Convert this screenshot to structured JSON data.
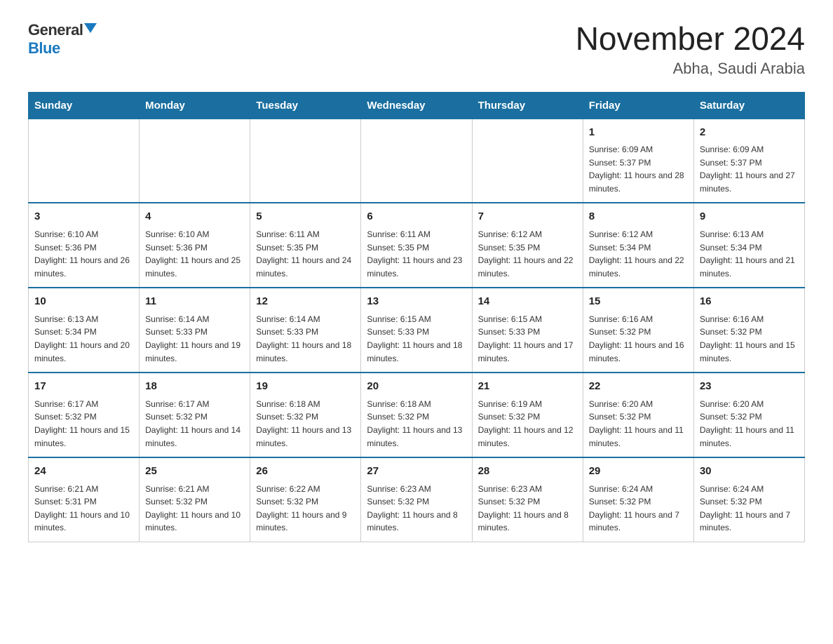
{
  "logo": {
    "general": "General",
    "blue": "Blue"
  },
  "title": "November 2024",
  "subtitle": "Abha, Saudi Arabia",
  "weekdays": [
    "Sunday",
    "Monday",
    "Tuesday",
    "Wednesday",
    "Thursday",
    "Friday",
    "Saturday"
  ],
  "weeks": [
    [
      {
        "day": "",
        "info": ""
      },
      {
        "day": "",
        "info": ""
      },
      {
        "day": "",
        "info": ""
      },
      {
        "day": "",
        "info": ""
      },
      {
        "day": "",
        "info": ""
      },
      {
        "day": "1",
        "info": "Sunrise: 6:09 AM\nSunset: 5:37 PM\nDaylight: 11 hours and 28 minutes."
      },
      {
        "day": "2",
        "info": "Sunrise: 6:09 AM\nSunset: 5:37 PM\nDaylight: 11 hours and 27 minutes."
      }
    ],
    [
      {
        "day": "3",
        "info": "Sunrise: 6:10 AM\nSunset: 5:36 PM\nDaylight: 11 hours and 26 minutes."
      },
      {
        "day": "4",
        "info": "Sunrise: 6:10 AM\nSunset: 5:36 PM\nDaylight: 11 hours and 25 minutes."
      },
      {
        "day": "5",
        "info": "Sunrise: 6:11 AM\nSunset: 5:35 PM\nDaylight: 11 hours and 24 minutes."
      },
      {
        "day": "6",
        "info": "Sunrise: 6:11 AM\nSunset: 5:35 PM\nDaylight: 11 hours and 23 minutes."
      },
      {
        "day": "7",
        "info": "Sunrise: 6:12 AM\nSunset: 5:35 PM\nDaylight: 11 hours and 22 minutes."
      },
      {
        "day": "8",
        "info": "Sunrise: 6:12 AM\nSunset: 5:34 PM\nDaylight: 11 hours and 22 minutes."
      },
      {
        "day": "9",
        "info": "Sunrise: 6:13 AM\nSunset: 5:34 PM\nDaylight: 11 hours and 21 minutes."
      }
    ],
    [
      {
        "day": "10",
        "info": "Sunrise: 6:13 AM\nSunset: 5:34 PM\nDaylight: 11 hours and 20 minutes."
      },
      {
        "day": "11",
        "info": "Sunrise: 6:14 AM\nSunset: 5:33 PM\nDaylight: 11 hours and 19 minutes."
      },
      {
        "day": "12",
        "info": "Sunrise: 6:14 AM\nSunset: 5:33 PM\nDaylight: 11 hours and 18 minutes."
      },
      {
        "day": "13",
        "info": "Sunrise: 6:15 AM\nSunset: 5:33 PM\nDaylight: 11 hours and 18 minutes."
      },
      {
        "day": "14",
        "info": "Sunrise: 6:15 AM\nSunset: 5:33 PM\nDaylight: 11 hours and 17 minutes."
      },
      {
        "day": "15",
        "info": "Sunrise: 6:16 AM\nSunset: 5:32 PM\nDaylight: 11 hours and 16 minutes."
      },
      {
        "day": "16",
        "info": "Sunrise: 6:16 AM\nSunset: 5:32 PM\nDaylight: 11 hours and 15 minutes."
      }
    ],
    [
      {
        "day": "17",
        "info": "Sunrise: 6:17 AM\nSunset: 5:32 PM\nDaylight: 11 hours and 15 minutes."
      },
      {
        "day": "18",
        "info": "Sunrise: 6:17 AM\nSunset: 5:32 PM\nDaylight: 11 hours and 14 minutes."
      },
      {
        "day": "19",
        "info": "Sunrise: 6:18 AM\nSunset: 5:32 PM\nDaylight: 11 hours and 13 minutes."
      },
      {
        "day": "20",
        "info": "Sunrise: 6:18 AM\nSunset: 5:32 PM\nDaylight: 11 hours and 13 minutes."
      },
      {
        "day": "21",
        "info": "Sunrise: 6:19 AM\nSunset: 5:32 PM\nDaylight: 11 hours and 12 minutes."
      },
      {
        "day": "22",
        "info": "Sunrise: 6:20 AM\nSunset: 5:32 PM\nDaylight: 11 hours and 11 minutes."
      },
      {
        "day": "23",
        "info": "Sunrise: 6:20 AM\nSunset: 5:32 PM\nDaylight: 11 hours and 11 minutes."
      }
    ],
    [
      {
        "day": "24",
        "info": "Sunrise: 6:21 AM\nSunset: 5:31 PM\nDaylight: 11 hours and 10 minutes."
      },
      {
        "day": "25",
        "info": "Sunrise: 6:21 AM\nSunset: 5:32 PM\nDaylight: 11 hours and 10 minutes."
      },
      {
        "day": "26",
        "info": "Sunrise: 6:22 AM\nSunset: 5:32 PM\nDaylight: 11 hours and 9 minutes."
      },
      {
        "day": "27",
        "info": "Sunrise: 6:23 AM\nSunset: 5:32 PM\nDaylight: 11 hours and 8 minutes."
      },
      {
        "day": "28",
        "info": "Sunrise: 6:23 AM\nSunset: 5:32 PM\nDaylight: 11 hours and 8 minutes."
      },
      {
        "day": "29",
        "info": "Sunrise: 6:24 AM\nSunset: 5:32 PM\nDaylight: 11 hours and 7 minutes."
      },
      {
        "day": "30",
        "info": "Sunrise: 6:24 AM\nSunset: 5:32 PM\nDaylight: 11 hours and 7 minutes."
      }
    ]
  ]
}
